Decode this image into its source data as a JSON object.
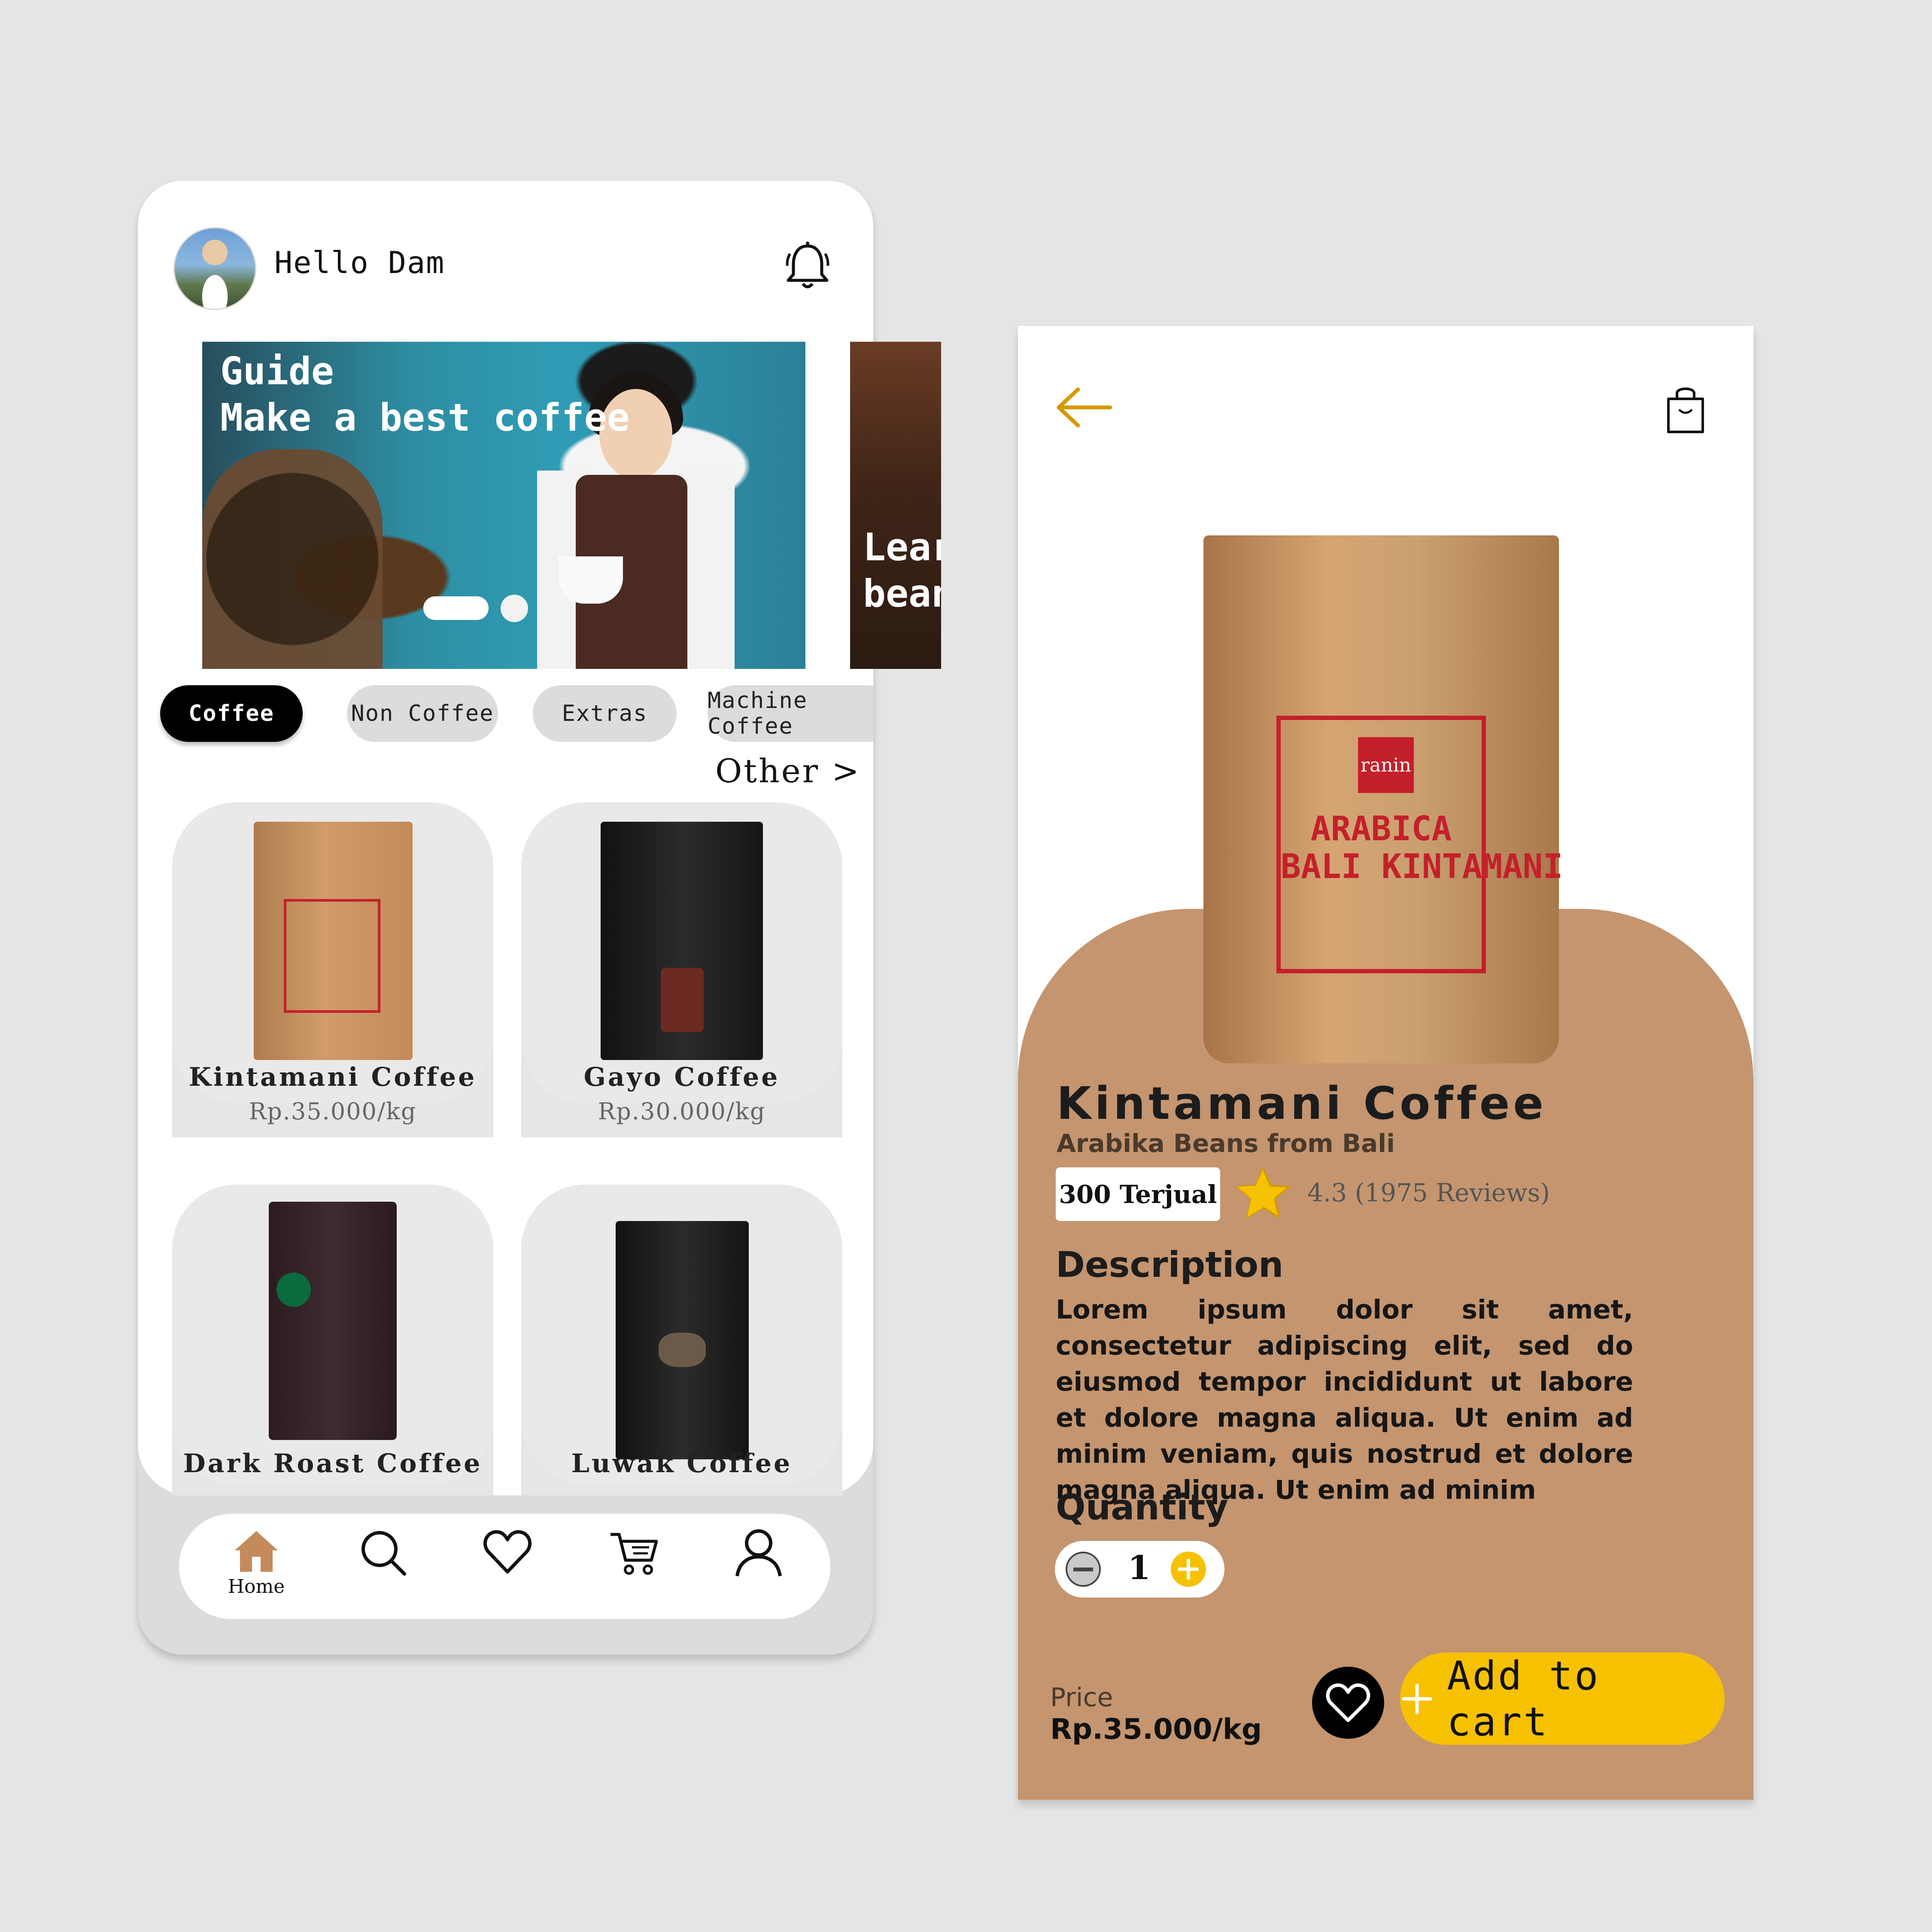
{
  "home": {
    "greeting": "Hello Dam",
    "banners": [
      {
        "title": "Guide\nMake a best coffee"
      },
      {
        "title": "Lear\nbean"
      }
    ],
    "categories": [
      {
        "label": "Coffee",
        "active": true
      },
      {
        "label": "Non Coffee",
        "active": false
      },
      {
        "label": "Extras",
        "active": false
      },
      {
        "label": "Machine Coffee",
        "active": false
      }
    ],
    "other_link": "Other >",
    "products": [
      {
        "name": "Kintamani Coffee",
        "price": "Rp.35.000/kg"
      },
      {
        "name": "Gayo Coffee",
        "price": "Rp.30.000/kg"
      },
      {
        "name": "Dark Roast Coffee",
        "price": ""
      },
      {
        "name": "Luwak Coffee",
        "price": ""
      }
    ],
    "nav": [
      {
        "icon": "home-icon",
        "label": "Home",
        "active": true
      },
      {
        "icon": "search-icon",
        "label": ""
      },
      {
        "icon": "heart-icon",
        "label": ""
      },
      {
        "icon": "cart-icon",
        "label": ""
      },
      {
        "icon": "user-icon",
        "label": ""
      }
    ]
  },
  "detail": {
    "title": "Kintamani Coffee",
    "subtitle": "Arabika Beans from Bali",
    "sold": "300 Terjual",
    "rating": "4.3 (1975 Reviews)",
    "bag_brand": "ranin",
    "bag_text": "ARABICA\nBALI KINTAMANI",
    "description_heading": "Description",
    "description": "Lorem ipsum dolor sit amet, consectetur adipiscing elit, sed do eiusmod tempor incididunt ut labore et dolore magna aliqua. Ut enim ad minim veniam, quis nostrud et dolore magna aliqua. Ut enim ad minim",
    "quantity_heading": "Quantity",
    "quantity": "1",
    "price_label": "Price",
    "price": "Rp.35.000/kg",
    "add_to_cart": "Add to cart"
  },
  "colors": {
    "background": "#e5e5e5",
    "accent_yellow": "#f6c100",
    "detail_brown": "#c4956f",
    "home_icon_brown": "#c48a5a",
    "back_arrow": "#d49a00"
  }
}
